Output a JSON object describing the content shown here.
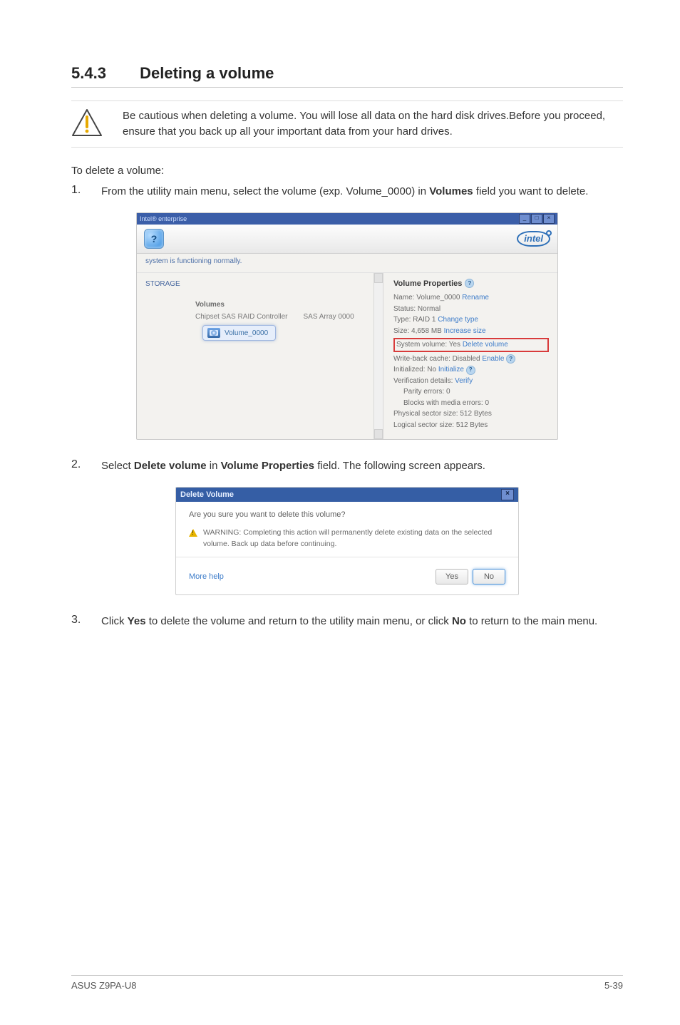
{
  "section": {
    "number": "5.4.3",
    "title": "Deleting a volume"
  },
  "caution": "Be cautious when deleting a volume. You will lose all data on the hard disk drives.Before you proceed, ensure that you back up all your important data from your hard drives.",
  "intro": "To delete a volume:",
  "steps": {
    "s1": {
      "num": "1.",
      "pre": "From the utility main menu, select the volume (exp. Volume_0000) in ",
      "bold": "Volumes",
      "post": " field you want to delete."
    },
    "s2": {
      "num": "2.",
      "pre": "Select ",
      "b1": "Delete volume",
      "mid": " in ",
      "b2": "Volume Properties",
      "post": " field. The following screen appears."
    },
    "s3": {
      "num": "3.",
      "pre": "Click ",
      "b1": "Yes",
      "mid": " to delete the volume and return to the utility main menu, or click ",
      "b2": "No",
      "post": " to return to the main menu."
    }
  },
  "ss1": {
    "titlebar": "Intel® enterprise",
    "winmin": "_",
    "winmax": "□",
    "winclose": "×",
    "help_badge": "?",
    "intel": "intel",
    "status": "system is functioning normally.",
    "storage_label": "STORAGE",
    "controller": "Chipset SAS RAID Controller",
    "sas_array": "SAS Array 0000",
    "volumes_head": "Volumes",
    "volume_chip": "Volume_0000",
    "props_head": "Volume Properties",
    "q": "?",
    "p_name_k": "Name:",
    "p_name_v": "Volume_0000",
    "p_name_link": "Rename",
    "p_status_k": "Status:",
    "p_status_v": "Normal",
    "p_type_k": "Type:",
    "p_type_v": "RAID 1",
    "p_type_link": "Change type",
    "p_size_k": "Size:",
    "p_size_v": "4,658 MB",
    "p_size_link": "Increase size",
    "p_sysvol": "System volume: Yes",
    "p_sysvol_link": "Delete volume",
    "p_wb": "Write-back cache: Disabled",
    "p_wb_link": "Enable",
    "p_init": "Initialized: No",
    "p_init_link": "Initialize",
    "p_verif": "Verification details:",
    "p_verif_link": "Verify",
    "p_parity": "Parity errors: 0",
    "p_blocks": "Blocks with media errors: 0",
    "p_phys": "Physical sector size: 512 Bytes",
    "p_log": "Logical sector size: 512 Bytes"
  },
  "ss2": {
    "title": "Delete Volume",
    "close": "×",
    "question": "Are you sure you want to delete this volume?",
    "warning": "WARNING: Completing this action will permanently delete existing data on the selected volume. Back up data before continuing.",
    "more": "More help",
    "yes": "Yes",
    "no": "No"
  },
  "footer": {
    "left": "ASUS Z9PA-U8",
    "right": "5-39"
  }
}
